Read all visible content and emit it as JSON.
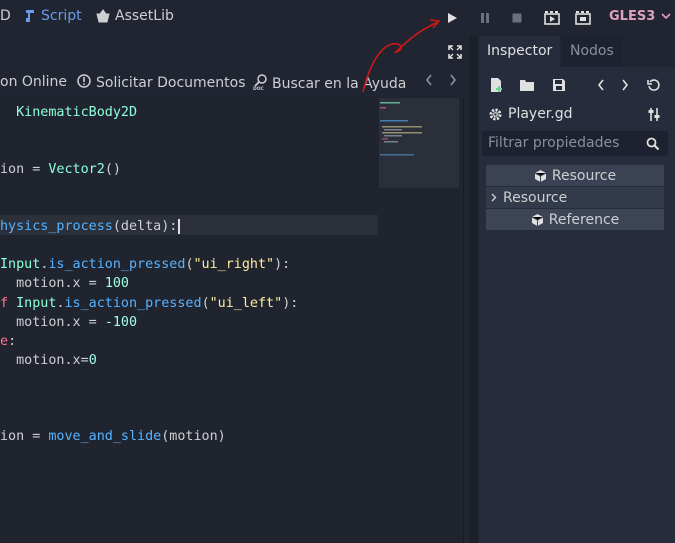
{
  "topbar": {
    "partial_label": "D",
    "script_label": "Script",
    "assetlib_label": "AssetLib",
    "renderer_label": "GLES3"
  },
  "script_toolbar": {
    "online_docs_label": "on Online",
    "request_docs_label": "Solicitar Documentos",
    "search_help_label": "Buscar en la Ayuda"
  },
  "editor": {
    "lines": [
      {
        "row": 0,
        "segments": [
          {
            "t": "  KinematicBody2D",
            "c": "ty"
          }
        ]
      },
      {
        "row": 3,
        "segments": [
          {
            "t": "ion = ",
            "c": ""
          },
          {
            "t": "Vector2",
            "c": "ty"
          },
          {
            "t": "()",
            "c": ""
          }
        ]
      },
      {
        "row": 6,
        "segments": [
          {
            "t": "hysics_process",
            "c": "fn"
          },
          {
            "t": "(delta):",
            "c": ""
          }
        ]
      },
      {
        "row": 8,
        "segments": [
          {
            "t": "Input",
            "c": "ty"
          },
          {
            "t": ".",
            "c": ""
          },
          {
            "t": "is_action_pressed",
            "c": "fn"
          },
          {
            "t": "(",
            "c": ""
          },
          {
            "t": "\"ui_right\"",
            "c": "st"
          },
          {
            "t": "):",
            "c": ""
          }
        ]
      },
      {
        "row": 9,
        "segments": [
          {
            "t": "  motion.x = ",
            "c": ""
          },
          {
            "t": "100",
            "c": "nm"
          }
        ]
      },
      {
        "row": 10,
        "segments": [
          {
            "t": "f ",
            "c": "kw"
          },
          {
            "t": "Input",
            "c": "ty"
          },
          {
            "t": ".",
            "c": ""
          },
          {
            "t": "is_action_pressed",
            "c": "fn"
          },
          {
            "t": "(",
            "c": ""
          },
          {
            "t": "\"ui_left\"",
            "c": "st"
          },
          {
            "t": "):",
            "c": ""
          }
        ]
      },
      {
        "row": 11,
        "segments": [
          {
            "t": "  motion.x = ",
            "c": ""
          },
          {
            "t": "-100",
            "c": "nm"
          }
        ]
      },
      {
        "row": 12,
        "segments": [
          {
            "t": "e",
            "c": "kw"
          },
          {
            "t": ":",
            "c": ""
          }
        ]
      },
      {
        "row": 13,
        "segments": [
          {
            "t": "  motion.x=",
            "c": ""
          },
          {
            "t": "0",
            "c": "nm"
          }
        ]
      },
      {
        "row": 17,
        "segments": [
          {
            "t": "ion = ",
            "c": ""
          },
          {
            "t": "move_and_slide",
            "c": "fn"
          },
          {
            "t": "(motion)",
            "c": ""
          }
        ]
      }
    ]
  },
  "inspector": {
    "tab_inspector": "Inspector",
    "tab_nodes": "Nodos",
    "file_name": "Player.gd",
    "filter_placeholder": "Filtrar propiedades",
    "section_resource_header": "Resource",
    "section_resource": "Resource",
    "section_reference": "Reference"
  },
  "colors": {
    "accent": "#699ce8",
    "renderer": "#e0a1bf",
    "annotation": "#d01818"
  }
}
